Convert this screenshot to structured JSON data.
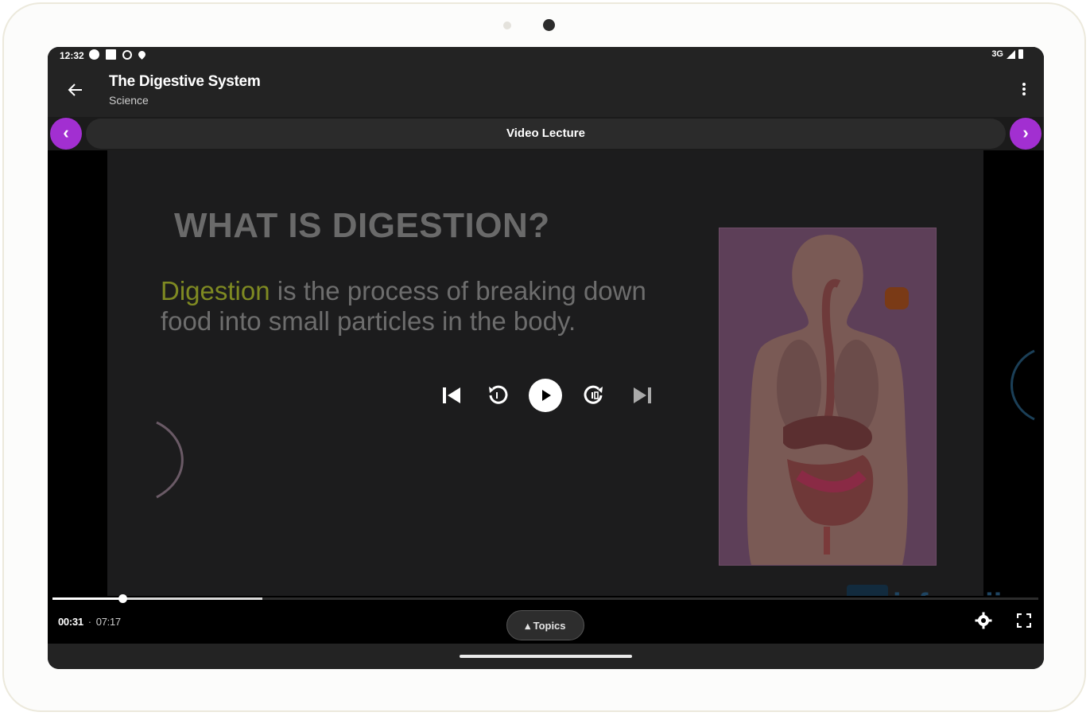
{
  "status_bar": {
    "time": "12:32",
    "network": "3G",
    "icons": [
      "circle-icon",
      "square-icon",
      "location-ring-icon",
      "location-pin-icon",
      "signal-icon",
      "battery-icon"
    ]
  },
  "app_bar": {
    "title": "The Digestive System",
    "subtitle": "Science",
    "back_icon": "back-arrow-icon",
    "menu_icon": "more-vert-icon"
  },
  "tab_nav": {
    "label": "Video Lecture",
    "prev_symbol": "‹",
    "next_symbol": "›",
    "accent": "#a22fd1"
  },
  "slide": {
    "title": "WHAT IS DIGESTION?",
    "highlight_word": "Digestion",
    "body_rest": " is the process of breaking down food into small particles in the body.",
    "watermark": "iafsawii"
  },
  "player": {
    "current_time": "00:31",
    "separator": "·",
    "duration": "07:17",
    "topics_label": "▴ Topics",
    "progress_fraction": 0.071,
    "buffer_fraction": 0.213,
    "controls": [
      "skip-previous-icon",
      "replay-10-icon",
      "play-icon",
      "forward-10-icon",
      "skip-next-icon"
    ],
    "settings_icon": "gear-icon",
    "fullscreen_icon": "fullscreen-icon"
  }
}
